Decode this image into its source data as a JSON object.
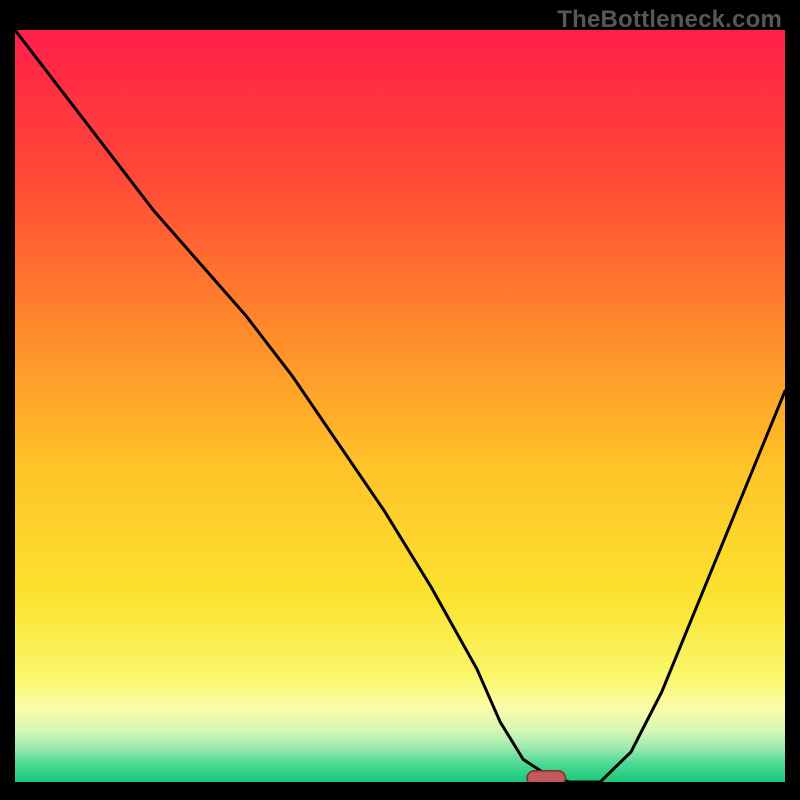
{
  "watermark": "TheBottleneck.com",
  "chart_data": {
    "type": "line",
    "title": "",
    "xlabel": "",
    "ylabel": "",
    "xlim": [
      0,
      100
    ],
    "ylim": [
      0,
      100
    ],
    "x": [
      0,
      6,
      12,
      18,
      24,
      30,
      36,
      42,
      48,
      54,
      60,
      63,
      66,
      69,
      72,
      76,
      80,
      84,
      88,
      92,
      96,
      100
    ],
    "values": [
      100,
      92,
      84,
      76,
      69,
      62,
      54,
      45,
      36,
      26,
      15,
      8,
      3,
      1,
      0,
      0,
      4,
      12,
      22,
      32,
      42,
      52
    ],
    "marker": {
      "x": 69,
      "y": 0.5,
      "width": 5,
      "height": 2
    },
    "gradient_stops": [
      {
        "offset": 0.0,
        "color": "#ff1f4a"
      },
      {
        "offset": 0.2,
        "color": "#ff4a37"
      },
      {
        "offset": 0.4,
        "color": "#ff8a2a"
      },
      {
        "offset": 0.58,
        "color": "#ffc328"
      },
      {
        "offset": 0.75,
        "color": "#fbe22e"
      },
      {
        "offset": 0.86,
        "color": "#faf76a"
      },
      {
        "offset": 0.9,
        "color": "#fbfca8"
      },
      {
        "offset": 0.93,
        "color": "#d9f7b4"
      },
      {
        "offset": 0.955,
        "color": "#9aeab0"
      },
      {
        "offset": 0.975,
        "color": "#4fd994"
      },
      {
        "offset": 1.0,
        "color": "#17c97a"
      }
    ],
    "line_color": "#000000",
    "line_width": 3,
    "marker_fill": "#c05a5a",
    "marker_stroke": "#7a2e2e"
  }
}
